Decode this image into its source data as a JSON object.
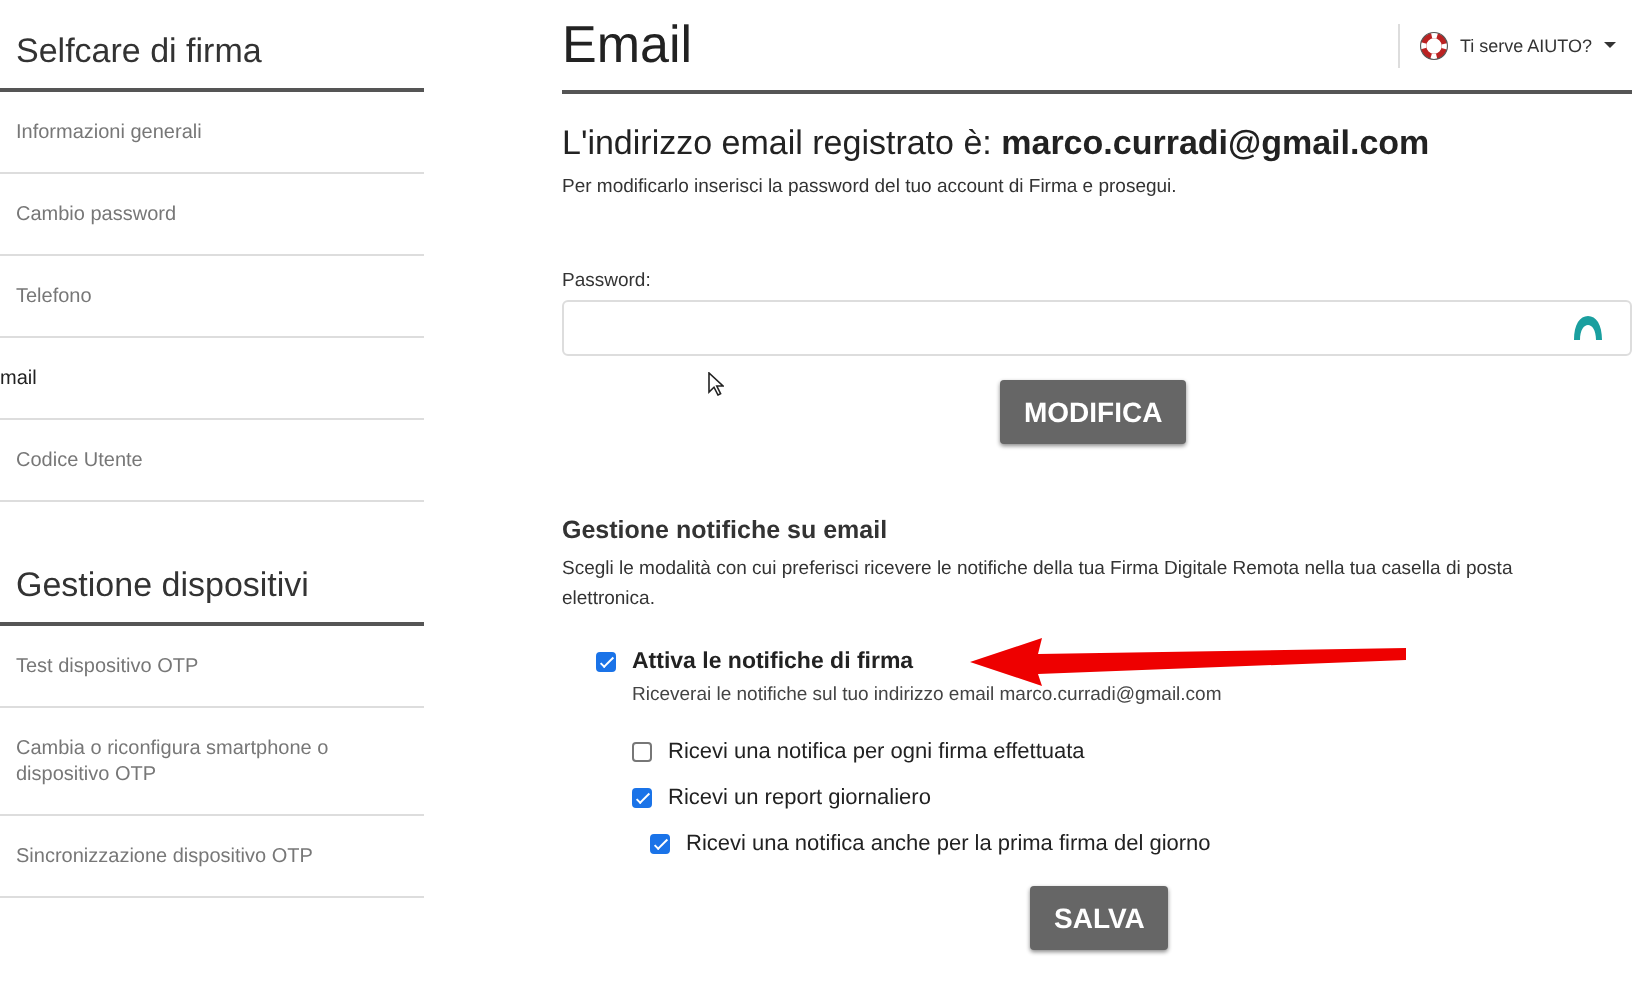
{
  "sidebar": {
    "sections": [
      {
        "title": "Selfcare di firma",
        "items": [
          {
            "label": "Informazioni generali",
            "selected": false
          },
          {
            "label": "Cambio password",
            "selected": false
          },
          {
            "label": "Telefono",
            "selected": false
          },
          {
            "label": "mail",
            "selected": true
          },
          {
            "label": "Codice Utente",
            "selected": false
          }
        ]
      },
      {
        "title": "Gestione dispositivi",
        "items": [
          {
            "label": "Test dispositivo OTP",
            "selected": false
          },
          {
            "label": "Cambia o riconfigura smartphone o dispositivo OTP",
            "selected": false
          },
          {
            "label": "Sincronizzazione dispositivo OTP",
            "selected": false
          }
        ]
      }
    ]
  },
  "page": {
    "title": "Email",
    "help_menu": {
      "label": "Ti serve AIUTO?"
    },
    "registered": "L'indirizzo email registrato è: **marco.curradi@gmail.com**",
    "instructions": "Per modificarlo inserisci la password del tuo account di Firma e prosegui.",
    "password": {
      "label": "Password:"
    },
    "modify_button": "MODIFICA",
    "notifications": {
      "title": "Gestione notifiche su email",
      "description": "Scegli le modalità con cui preferisci ricevere le notifiche della tua Firma Digitale Remota nella tua casella di posta elettronica.",
      "main": {
        "label": "Attiva le notifiche di firma",
        "checked": true,
        "hint": "Riceverai le notifiche sul tuo indirizzo email marco.curradi@gmail.com"
      },
      "options": [
        {
          "label": "Ricevi una notifica per ogni firma effettuata",
          "checked": false
        },
        {
          "label": "Ricevi un report giornaliero",
          "checked": true,
          "children": [
            {
              "label": "Ricevi una notifica anche per la prima firma del giorno",
              "checked": true
            }
          ]
        }
      ]
    },
    "save_button": "SALVA"
  }
}
